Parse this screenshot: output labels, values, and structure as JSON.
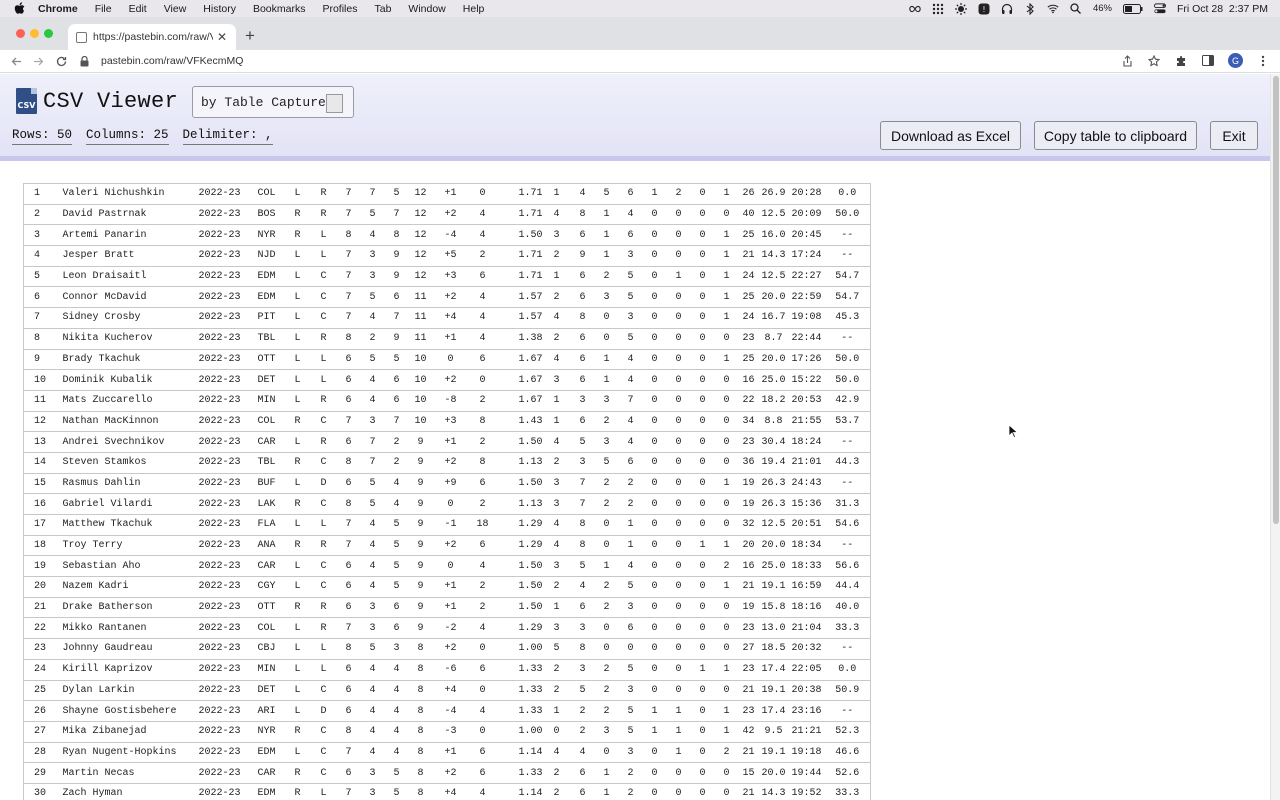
{
  "menubar": {
    "items": [
      "Chrome",
      "File",
      "Edit",
      "View",
      "History",
      "Bookmarks",
      "Profiles",
      "Tab",
      "Window",
      "Help"
    ],
    "battery": "46%",
    "datetime": "Fri Oct 28  2:37 PM"
  },
  "browser": {
    "tab_title": "https://pastebin.com/raw/VFKe",
    "url": "pastebin.com/raw/VFKecmMQ"
  },
  "viewer": {
    "logo_text": "CSV",
    "title": "CSV Viewer",
    "by_label": "by Table Capture",
    "rows_label": "Rows: 50",
    "columns_label": "Columns: 25",
    "delimiter_label": "Delimiter: ,",
    "download_label": "Download as Excel",
    "copy_label": "Copy table to clipboard",
    "exit_label": "Exit"
  },
  "table": {
    "rows": [
      [
        "1",
        "Valeri Nichushkin",
        "2022-23",
        "COL",
        "L",
        "R",
        "7",
        "7",
        "5",
        "12",
        "+1",
        "0",
        "1.71",
        "1",
        "4",
        "5",
        "6",
        "1",
        "2",
        "0",
        "1",
        "26",
        "26.9",
        "20:28",
        "0.0"
      ],
      [
        "2",
        "David Pastrnak",
        "2022-23",
        "BOS",
        "R",
        "R",
        "7",
        "5",
        "7",
        "12",
        "+2",
        "4",
        "1.71",
        "4",
        "8",
        "1",
        "4",
        "0",
        "0",
        "0",
        "0",
        "40",
        "12.5",
        "20:09",
        "50.0"
      ],
      [
        "3",
        "Artemi Panarin",
        "2022-23",
        "NYR",
        "R",
        "L",
        "8",
        "4",
        "8",
        "12",
        "-4",
        "4",
        "1.50",
        "3",
        "6",
        "1",
        "6",
        "0",
        "0",
        "0",
        "1",
        "25",
        "16.0",
        "20:45",
        "--"
      ],
      [
        "4",
        "Jesper Bratt",
        "2022-23",
        "NJD",
        "L",
        "L",
        "7",
        "3",
        "9",
        "12",
        "+5",
        "2",
        "1.71",
        "2",
        "9",
        "1",
        "3",
        "0",
        "0",
        "0",
        "1",
        "21",
        "14.3",
        "17:24",
        "--"
      ],
      [
        "5",
        "Leon Draisaitl",
        "2022-23",
        "EDM",
        "L",
        "C",
        "7",
        "3",
        "9",
        "12",
        "+3",
        "6",
        "1.71",
        "1",
        "6",
        "2",
        "5",
        "0",
        "1",
        "0",
        "1",
        "24",
        "12.5",
        "22:27",
        "54.7"
      ],
      [
        "6",
        "Connor McDavid",
        "2022-23",
        "EDM",
        "L",
        "C",
        "7",
        "5",
        "6",
        "11",
        "+2",
        "4",
        "1.57",
        "2",
        "6",
        "3",
        "5",
        "0",
        "0",
        "0",
        "1",
        "25",
        "20.0",
        "22:59",
        "54.7"
      ],
      [
        "7",
        "Sidney Crosby",
        "2022-23",
        "PIT",
        "L",
        "C",
        "7",
        "4",
        "7",
        "11",
        "+4",
        "4",
        "1.57",
        "4",
        "8",
        "0",
        "3",
        "0",
        "0",
        "0",
        "1",
        "24",
        "16.7",
        "19:08",
        "45.3"
      ],
      [
        "8",
        "Nikita Kucherov",
        "2022-23",
        "TBL",
        "L",
        "R",
        "8",
        "2",
        "9",
        "11",
        "+1",
        "4",
        "1.38",
        "2",
        "6",
        "0",
        "5",
        "0",
        "0",
        "0",
        "0",
        "23",
        "8.7",
        "22:44",
        "--"
      ],
      [
        "9",
        "Brady Tkachuk",
        "2022-23",
        "OTT",
        "L",
        "L",
        "6",
        "5",
        "5",
        "10",
        "0",
        "6",
        "1.67",
        "4",
        "6",
        "1",
        "4",
        "0",
        "0",
        "0",
        "1",
        "25",
        "20.0",
        "17:26",
        "50.0"
      ],
      [
        "10",
        "Dominik Kubalik",
        "2022-23",
        "DET",
        "L",
        "L",
        "6",
        "4",
        "6",
        "10",
        "+2",
        "0",
        "1.67",
        "3",
        "6",
        "1",
        "4",
        "0",
        "0",
        "0",
        "0",
        "16",
        "25.0",
        "15:22",
        "50.0"
      ],
      [
        "11",
        "Mats Zuccarello",
        "2022-23",
        "MIN",
        "L",
        "R",
        "6",
        "4",
        "6",
        "10",
        "-8",
        "2",
        "1.67",
        "1",
        "3",
        "3",
        "7",
        "0",
        "0",
        "0",
        "0",
        "22",
        "18.2",
        "20:53",
        "42.9"
      ],
      [
        "12",
        "Nathan MacKinnon",
        "2022-23",
        "COL",
        "R",
        "C",
        "7",
        "3",
        "7",
        "10",
        "+3",
        "8",
        "1.43",
        "1",
        "6",
        "2",
        "4",
        "0",
        "0",
        "0",
        "0",
        "34",
        "8.8",
        "21:55",
        "53.7"
      ],
      [
        "13",
        "Andrei Svechnikov",
        "2022-23",
        "CAR",
        "L",
        "R",
        "6",
        "7",
        "2",
        "9",
        "+1",
        "2",
        "1.50",
        "4",
        "5",
        "3",
        "4",
        "0",
        "0",
        "0",
        "0",
        "23",
        "30.4",
        "18:24",
        "--"
      ],
      [
        "14",
        "Steven Stamkos",
        "2022-23",
        "TBL",
        "R",
        "C",
        "8",
        "7",
        "2",
        "9",
        "+2",
        "8",
        "1.13",
        "2",
        "3",
        "5",
        "6",
        "0",
        "0",
        "0",
        "0",
        "36",
        "19.4",
        "21:01",
        "44.3"
      ],
      [
        "15",
        "Rasmus Dahlin",
        "2022-23",
        "BUF",
        "L",
        "D",
        "6",
        "5",
        "4",
        "9",
        "+9",
        "6",
        "1.50",
        "3",
        "7",
        "2",
        "2",
        "0",
        "0",
        "0",
        "1",
        "19",
        "26.3",
        "24:43",
        "--"
      ],
      [
        "16",
        "Gabriel Vilardi",
        "2022-23",
        "LAK",
        "R",
        "C",
        "8",
        "5",
        "4",
        "9",
        "0",
        "2",
        "1.13",
        "3",
        "7",
        "2",
        "2",
        "0",
        "0",
        "0",
        "0",
        "19",
        "26.3",
        "15:36",
        "31.3"
      ],
      [
        "17",
        "Matthew Tkachuk",
        "2022-23",
        "FLA",
        "L",
        "L",
        "7",
        "4",
        "5",
        "9",
        "-1",
        "18",
        "1.29",
        "4",
        "8",
        "0",
        "1",
        "0",
        "0",
        "0",
        "0",
        "32",
        "12.5",
        "20:51",
        "54.6"
      ],
      [
        "18",
        "Troy Terry",
        "2022-23",
        "ANA",
        "R",
        "R",
        "7",
        "4",
        "5",
        "9",
        "+2",
        "6",
        "1.29",
        "4",
        "8",
        "0",
        "1",
        "0",
        "0",
        "1",
        "1",
        "20",
        "20.0",
        "18:34",
        "--"
      ],
      [
        "19",
        "Sebastian Aho",
        "2022-23",
        "CAR",
        "L",
        "C",
        "6",
        "4",
        "5",
        "9",
        "0",
        "4",
        "1.50",
        "3",
        "5",
        "1",
        "4",
        "0",
        "0",
        "0",
        "2",
        "16",
        "25.0",
        "18:33",
        "56.6"
      ],
      [
        "20",
        "Nazem Kadri",
        "2022-23",
        "CGY",
        "L",
        "C",
        "6",
        "4",
        "5",
        "9",
        "+1",
        "2",
        "1.50",
        "2",
        "4",
        "2",
        "5",
        "0",
        "0",
        "0",
        "1",
        "21",
        "19.1",
        "16:59",
        "44.4"
      ],
      [
        "21",
        "Drake Batherson",
        "2022-23",
        "OTT",
        "R",
        "R",
        "6",
        "3",
        "6",
        "9",
        "+1",
        "2",
        "1.50",
        "1",
        "6",
        "2",
        "3",
        "0",
        "0",
        "0",
        "0",
        "19",
        "15.8",
        "18:16",
        "40.0"
      ],
      [
        "22",
        "Mikko Rantanen",
        "2022-23",
        "COL",
        "L",
        "R",
        "7",
        "3",
        "6",
        "9",
        "-2",
        "4",
        "1.29",
        "3",
        "3",
        "0",
        "6",
        "0",
        "0",
        "0",
        "0",
        "23",
        "13.0",
        "21:04",
        "33.3"
      ],
      [
        "23",
        "Johnny Gaudreau",
        "2022-23",
        "CBJ",
        "L",
        "L",
        "8",
        "5",
        "3",
        "8",
        "+2",
        "0",
        "1.00",
        "5",
        "8",
        "0",
        "0",
        "0",
        "0",
        "0",
        "0",
        "27",
        "18.5",
        "20:32",
        "--"
      ],
      [
        "24",
        "Kirill Kaprizov",
        "2022-23",
        "MIN",
        "L",
        "L",
        "6",
        "4",
        "4",
        "8",
        "-6",
        "6",
        "1.33",
        "2",
        "3",
        "2",
        "5",
        "0",
        "0",
        "1",
        "1",
        "23",
        "17.4",
        "22:05",
        "0.0"
      ],
      [
        "25",
        "Dylan Larkin",
        "2022-23",
        "DET",
        "L",
        "C",
        "6",
        "4",
        "4",
        "8",
        "+4",
        "0",
        "1.33",
        "2",
        "5",
        "2",
        "3",
        "0",
        "0",
        "0",
        "0",
        "21",
        "19.1",
        "20:38",
        "50.9"
      ],
      [
        "26",
        "Shayne Gostisbehere",
        "2022-23",
        "ARI",
        "L",
        "D",
        "6",
        "4",
        "4",
        "8",
        "-4",
        "4",
        "1.33",
        "1",
        "2",
        "2",
        "5",
        "1",
        "1",
        "0",
        "1",
        "23",
        "17.4",
        "23:16",
        "--"
      ],
      [
        "27",
        "Mika Zibanejad",
        "2022-23",
        "NYR",
        "R",
        "C",
        "8",
        "4",
        "4",
        "8",
        "-3",
        "0",
        "1.00",
        "0",
        "2",
        "3",
        "5",
        "1",
        "1",
        "0",
        "1",
        "42",
        "9.5",
        "21:21",
        "52.3"
      ],
      [
        "28",
        "Ryan Nugent-Hopkins",
        "2022-23",
        "EDM",
        "L",
        "C",
        "7",
        "4",
        "4",
        "8",
        "+1",
        "6",
        "1.14",
        "4",
        "4",
        "0",
        "3",
        "0",
        "1",
        "0",
        "2",
        "21",
        "19.1",
        "19:18",
        "46.6"
      ],
      [
        "29",
        "Martin Necas",
        "2022-23",
        "CAR",
        "R",
        "C",
        "6",
        "3",
        "5",
        "8",
        "+2",
        "6",
        "1.33",
        "2",
        "6",
        "1",
        "2",
        "0",
        "0",
        "0",
        "0",
        "15",
        "20.0",
        "19:44",
        "52.6"
      ],
      [
        "30",
        "Zach Hyman",
        "2022-23",
        "EDM",
        "R",
        "L",
        "7",
        "3",
        "5",
        "8",
        "+4",
        "4",
        "1.14",
        "2",
        "6",
        "1",
        "2",
        "0",
        "0",
        "0",
        "0",
        "21",
        "14.3",
        "19:52",
        "33.3"
      ]
    ]
  }
}
